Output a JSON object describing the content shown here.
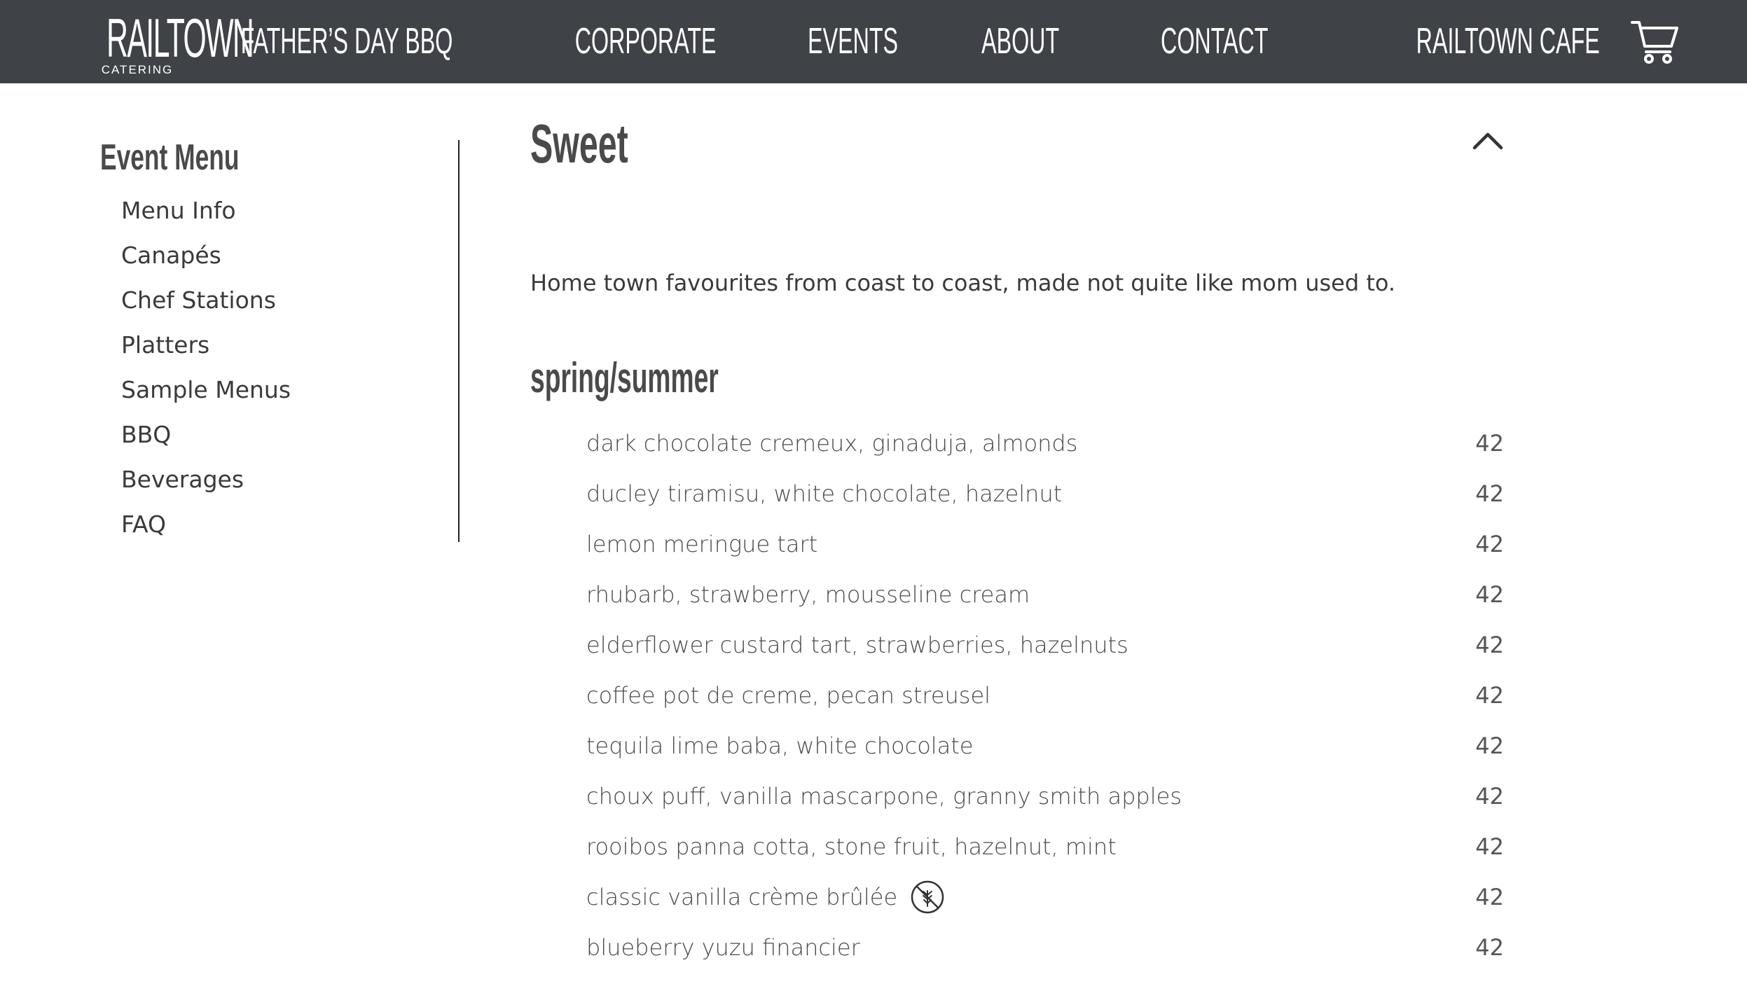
{
  "brand": {
    "name": "RAILTOWN",
    "tagline": "CATERING"
  },
  "nav": {
    "items": [
      "FATHER’S DAY BBQ",
      "CORPORATE",
      "EVENTS",
      "ABOUT",
      "CONTACT",
      "RAILTOWN CAFE"
    ],
    "cart_icon": "shopping-cart-icon"
  },
  "sidebar": {
    "title": "Event Menu",
    "items": [
      "Menu Info",
      "Canapés",
      "Chef Stations",
      "Platters",
      "Sample Menus",
      "BBQ",
      "Beverages",
      "FAQ"
    ]
  },
  "section": {
    "title": "Sweet",
    "collapse_icon": "chevron-up-icon",
    "intro": "Home town favourites from coast to coast, made not quite like mom used to.",
    "subheading": "spring/summer",
    "items": [
      {
        "name": "dark chocolate cremeux, ginaduja, almonds",
        "price": "42"
      },
      {
        "name": "ducley tiramisu, white chocolate, hazelnut",
        "price": "42"
      },
      {
        "name": "lemon meringue tart",
        "price": "42"
      },
      {
        "name": "rhubarb, strawberry, mousseline cream",
        "price": "42"
      },
      {
        "name": "elderflower custard tart, strawberries, hazelnuts",
        "price": "42"
      },
      {
        "name": "coffee pot de creme, pecan streusel",
        "price": "42"
      },
      {
        "name": "tequila lime baba, white chocolate",
        "price": "42"
      },
      {
        "name": "choux puff, vanilla mascarpone, granny smith apples",
        "price": "42"
      },
      {
        "name": "rooibos panna cotta, stone fruit, hazelnut, mint",
        "price": "42"
      },
      {
        "name": "classic vanilla crème brûlée",
        "price": "42",
        "icon": "gluten-free-icon"
      },
      {
        "name": "blueberry yuzu financier",
        "price": "42"
      }
    ]
  },
  "colors": {
    "header_bg": "#3f4247",
    "text": "#4a4a4a",
    "header_text": "#ffffff"
  }
}
